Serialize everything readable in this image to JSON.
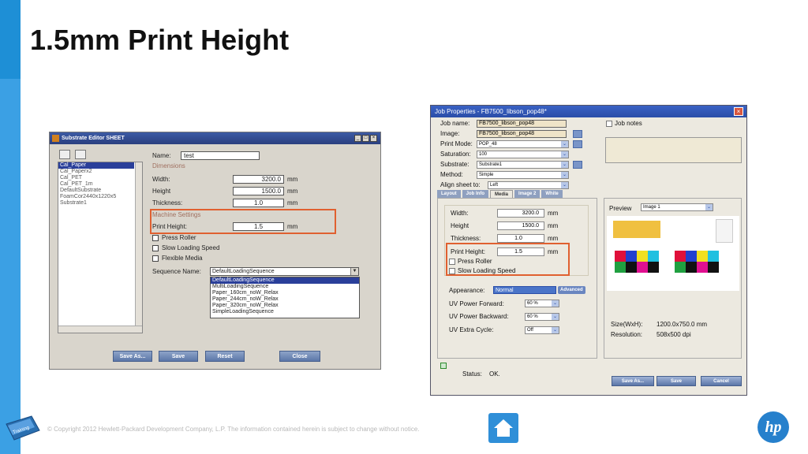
{
  "slide": {
    "title": "1.5mm Print Height",
    "footer": "© Copyright 2012 Hewlett-Packard Development Company, L.P.  The information contained herein is subject to change without notice.",
    "hp_logo": "hp",
    "book_label": "Training",
    "accent_color": "#1e8fd6",
    "highlight_color": "#e06030"
  },
  "substrate_editor": {
    "title": "Substrate Editor SHEET",
    "list": [
      "Cal_Paper",
      "Cal_Paperx2",
      "Cal_PET",
      "Cal_PET_1m",
      "DefaultSubstrate",
      "FoamCor2440x1220x5",
      "Substrate1"
    ],
    "name_label": "Name:",
    "name_value": "test",
    "dimensions_label": "Dimensions",
    "width_label": "Width:",
    "width_value": "3200.0",
    "height_label": "Height",
    "height_value": "1500.0",
    "thickness_label": "Thickness:",
    "thickness_value": "1.0",
    "unit": "mm",
    "machine_settings_label": "Machine Settings",
    "print_height_label": "Print Height:",
    "print_height_value": "1.5",
    "press_roller": "Press Roller",
    "slow_loading": "Slow Loading Speed",
    "flexible_media": "Flexible Media",
    "sequence_label": "Sequence Name:",
    "sequence_value": "DefaultLoadingSequence",
    "sequence_options": [
      "DefaultLoadingSequence",
      "MultiLoadingSequence",
      "Paper_160cm_noW_Relax",
      "Paper_244cm_noW_Relax",
      "Paper_320cm_noW_Relax",
      "SimpleLoadingSequence"
    ],
    "buttons": {
      "save_as": "Save As...",
      "save": "Save",
      "reset": "Reset",
      "close": "Close"
    }
  },
  "job_properties": {
    "title": "Job Properties - FB7500_libson_pop48*",
    "job_name_label": "Job name:",
    "job_name_value": "FB7500_libson_pop48",
    "image_label": "Image:",
    "image_value": "FB7500_libson_pop48",
    "print_mode_label": "Print Mode:",
    "print_mode_value": "POP_48",
    "saturation_label": "Saturation:",
    "saturation_value": "100",
    "substrate_label": "Substrate:",
    "substrate_value": "Substrate1",
    "method_label": "Method:",
    "method_value": "Simple",
    "align_label": "Align sheet to:",
    "align_value": "Left",
    "job_notes": "Job notes",
    "tabs": [
      "Layout",
      "Job Info",
      "Media",
      "Image 2",
      "White"
    ],
    "width_label": "Width:",
    "width_value": "3200.0",
    "height_label": "Height",
    "height_value": "1500.0",
    "thickness_label": "Thickness:",
    "thickness_value": "1.0",
    "unit": "mm",
    "print_height_label": "Print Height:",
    "print_height_value": "1.5",
    "press_roller": "Press Roller",
    "slow_loading": "Slow Loading Speed",
    "appearance_label": "Appearance:",
    "appearance_value": "Normal",
    "advanced": "Advanced",
    "uv_forward_label": "UV Power Forward:",
    "uv_forward_value": "60 %",
    "uv_backward_label": "UV Power Backward:",
    "uv_backward_value": "60 %",
    "uv_extra_label": "UV Extra Cycle:",
    "uv_extra_value": "Off",
    "preview_label": "Preview",
    "preview_value": "Image 1",
    "size_label": "Size(WxH):",
    "size_value": "1200.0x750.0 mm",
    "resolution_label": "Resolution:",
    "resolution_value": "508x500 dpi",
    "status_label": "Status:",
    "status_value": "OK.",
    "buttons": {
      "save_as": "Save As...",
      "save": "Save",
      "cancel": "Cancel"
    }
  }
}
